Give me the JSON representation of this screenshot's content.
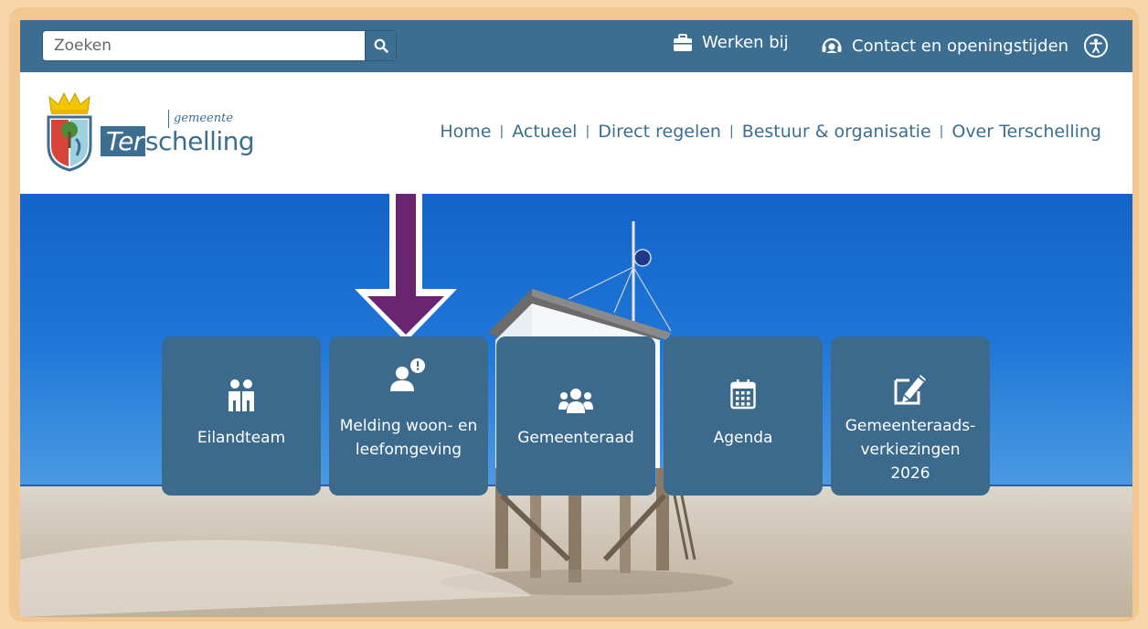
{
  "search": {
    "placeholder": "Zoeken"
  },
  "topbar": {
    "links": [
      {
        "label": "Werken bij",
        "icon": "briefcase-icon"
      },
      {
        "label": "Contact en openingstijden",
        "icon": "headset-icon"
      }
    ],
    "accessibility_icon": "accessibility-icon"
  },
  "logo": {
    "sub": "gemeente",
    "name_prefix": "Ter",
    "name_suffix": "schelling"
  },
  "nav": {
    "items": [
      "Home",
      "Actueel",
      "Direct regelen",
      "Bestuur & organisatie",
      "Over Terschelling"
    ]
  },
  "tiles": [
    {
      "label": "Eilandteam",
      "icon": "team-icon"
    },
    {
      "label_line1": "Melding woon- en",
      "label_line2": "leefomgeving",
      "icon": "report-icon"
    },
    {
      "label": "Gemeenteraad",
      "icon": "council-icon"
    },
    {
      "label": "Agenda",
      "icon": "calendar-icon"
    },
    {
      "label_line1": "Gemeenteraads-",
      "label_line2": "verkiezingen 2026",
      "icon": "pencil-icon"
    }
  ],
  "colors": {
    "brand": "#3c6e92",
    "tile": "#3c6a8c",
    "arrow": "#6b2470",
    "frame": "#f2c792"
  }
}
